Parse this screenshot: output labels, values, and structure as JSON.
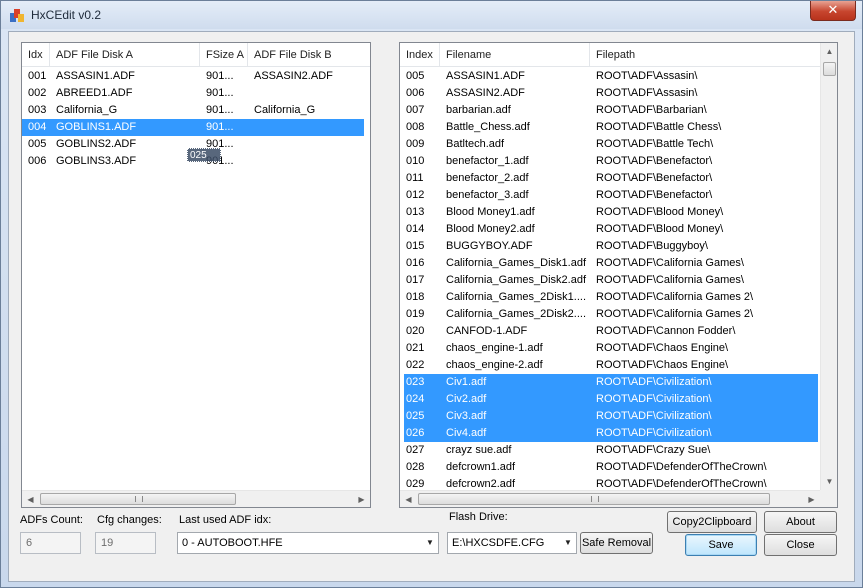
{
  "window": {
    "title": "HxCEdit v0.2",
    "close_label": "✕"
  },
  "left_list": {
    "columns": [
      "Idx",
      "ADF File Disk A",
      "FSize A",
      "ADF File Disk B"
    ],
    "rows": [
      {
        "idx": "001",
        "disk_a": "ASSASIN1.ADF",
        "fsize_a": "901...",
        "disk_b": "ASSASIN2.ADF",
        "selected": false
      },
      {
        "idx": "002",
        "disk_a": "ABREED1.ADF",
        "fsize_a": "901...",
        "disk_b": "",
        "selected": false
      },
      {
        "idx": "003",
        "disk_a": "California_G",
        "fsize_a": "901...",
        "disk_b": "California_G",
        "selected": false
      },
      {
        "idx": "004",
        "disk_a": "GOBLINS1.ADF",
        "fsize_a": "901...",
        "disk_b": "",
        "selected": true
      },
      {
        "idx": "005",
        "disk_a": "GOBLINS2.ADF",
        "fsize_a": "901...",
        "disk_b": "",
        "selected": false
      },
      {
        "idx": "006",
        "disk_a": "GOBLINS3.ADF",
        "fsize_a": "901...",
        "disk_b": "",
        "selected": false
      }
    ],
    "drag_label": "025"
  },
  "right_list": {
    "columns": [
      "Index",
      "Filename",
      "Filepath"
    ],
    "rows": [
      {
        "index": "005",
        "filename": "ASSASIN1.ADF",
        "filepath": "ROOT\\ADF\\Assasin\\",
        "selected": false
      },
      {
        "index": "006",
        "filename": "ASSASIN2.ADF",
        "filepath": "ROOT\\ADF\\Assasin\\",
        "selected": false
      },
      {
        "index": "007",
        "filename": "barbarian.adf",
        "filepath": "ROOT\\ADF\\Barbarian\\",
        "selected": false
      },
      {
        "index": "008",
        "filename": "Battle_Chess.adf",
        "filepath": "ROOT\\ADF\\Battle Chess\\",
        "selected": false
      },
      {
        "index": "009",
        "filename": "Batltech.adf",
        "filepath": "ROOT\\ADF\\Battle Tech\\",
        "selected": false
      },
      {
        "index": "010",
        "filename": "benefactor_1.adf",
        "filepath": "ROOT\\ADF\\Benefactor\\",
        "selected": false
      },
      {
        "index": "011",
        "filename": "benefactor_2.adf",
        "filepath": "ROOT\\ADF\\Benefactor\\",
        "selected": false
      },
      {
        "index": "012",
        "filename": "benefactor_3.adf",
        "filepath": "ROOT\\ADF\\Benefactor\\",
        "selected": false
      },
      {
        "index": "013",
        "filename": "Blood Money1.adf",
        "filepath": "ROOT\\ADF\\Blood Money\\",
        "selected": false
      },
      {
        "index": "014",
        "filename": "Blood Money2.adf",
        "filepath": "ROOT\\ADF\\Blood Money\\",
        "selected": false
      },
      {
        "index": "015",
        "filename": "BUGGYBOY.ADF",
        "filepath": "ROOT\\ADF\\Buggyboy\\",
        "selected": false
      },
      {
        "index": "016",
        "filename": "California_Games_Disk1.adf",
        "filepath": "ROOT\\ADF\\California Games\\",
        "selected": false
      },
      {
        "index": "017",
        "filename": "California_Games_Disk2.adf",
        "filepath": "ROOT\\ADF\\California Games\\",
        "selected": false
      },
      {
        "index": "018",
        "filename": "California_Games_2Disk1....",
        "filepath": "ROOT\\ADF\\California Games 2\\",
        "selected": false
      },
      {
        "index": "019",
        "filename": "California_Games_2Disk2....",
        "filepath": "ROOT\\ADF\\California Games 2\\",
        "selected": false
      },
      {
        "index": "020",
        "filename": "CANFOD-1.ADF",
        "filepath": "ROOT\\ADF\\Cannon Fodder\\",
        "selected": false
      },
      {
        "index": "021",
        "filename": "chaos_engine-1.adf",
        "filepath": "ROOT\\ADF\\Chaos Engine\\",
        "selected": false
      },
      {
        "index": "022",
        "filename": "chaos_engine-2.adf",
        "filepath": "ROOT\\ADF\\Chaos Engine\\",
        "selected": false
      },
      {
        "index": "023",
        "filename": "Civ1.adf",
        "filepath": "ROOT\\ADF\\Civilization\\",
        "selected": true
      },
      {
        "index": "024",
        "filename": "Civ2.adf",
        "filepath": "ROOT\\ADF\\Civilization\\",
        "selected": true
      },
      {
        "index": "025",
        "filename": "Civ3.adf",
        "filepath": "ROOT\\ADF\\Civilization\\",
        "selected": true
      },
      {
        "index": "026",
        "filename": "Civ4.adf",
        "filepath": "ROOT\\ADF\\Civilization\\",
        "selected": true
      },
      {
        "index": "027",
        "filename": "crayz sue.adf",
        "filepath": "ROOT\\ADF\\Crazy Sue\\",
        "selected": false
      },
      {
        "index": "028",
        "filename": "defcrown1.adf",
        "filepath": "ROOT\\ADF\\DefenderOfTheCrown\\",
        "selected": false
      },
      {
        "index": "029",
        "filename": "defcrown2.adf",
        "filepath": "ROOT\\ADF\\DefenderOfTheCrown\\",
        "selected": false
      }
    ]
  },
  "bottom": {
    "adfs_count_label": "ADFs Count:",
    "adfs_count_value": "6",
    "cfg_changes_label": "Cfg changes:",
    "cfg_changes_value": "19",
    "last_used_label": "Last used ADF idx:",
    "last_used_value": "0 - AUTOBOOT.HFE",
    "flash_drive_label": "Flash Drive:",
    "flash_drive_value": "E:\\HXCSDFE.CFG",
    "safe_removal": "Safe Removal",
    "copy2clipboard": "Copy2Clipboard",
    "about": "About",
    "save": "Save",
    "close": "Close"
  }
}
